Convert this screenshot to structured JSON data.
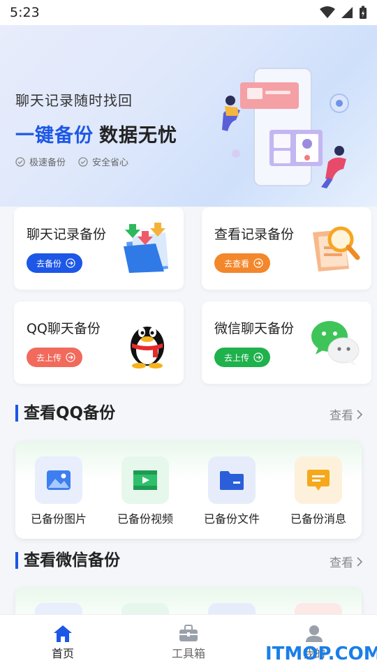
{
  "status_bar": {
    "time": "5:23"
  },
  "hero": {
    "subtitle": "聊天记录随时找回",
    "title_blue": "一键备份",
    "title_dark": "数据无忧",
    "tags": [
      "极速备份",
      "安全省心"
    ]
  },
  "cards": [
    {
      "title": "聊天记录备份",
      "button": "去备份",
      "color": "#1c57e6"
    },
    {
      "title": "查看记录备份",
      "button": "去查看",
      "color": "#f3872b"
    },
    {
      "title": "QQ聊天备份",
      "button": "去上传",
      "color": "#f16a5c"
    },
    {
      "title": "微信聊天备份",
      "button": "去上传",
      "color": "#1fb14c"
    }
  ],
  "qq_section": {
    "title": "查看QQ备份",
    "more": "查看",
    "items": [
      {
        "label": "已备份图片",
        "icon": "image-icon"
      },
      {
        "label": "已备份视频",
        "icon": "video-icon"
      },
      {
        "label": "已备份文件",
        "icon": "folder-icon"
      },
      {
        "label": "已备份消息",
        "icon": "message-icon"
      }
    ]
  },
  "wechat_section": {
    "title": "查看微信备份",
    "more": "查看"
  },
  "tabbar": {
    "items": [
      "首页",
      "工具箱",
      "我的"
    ]
  },
  "watermark": "ITMOP.COM",
  "colors": {
    "accent": "#1c57e6"
  }
}
